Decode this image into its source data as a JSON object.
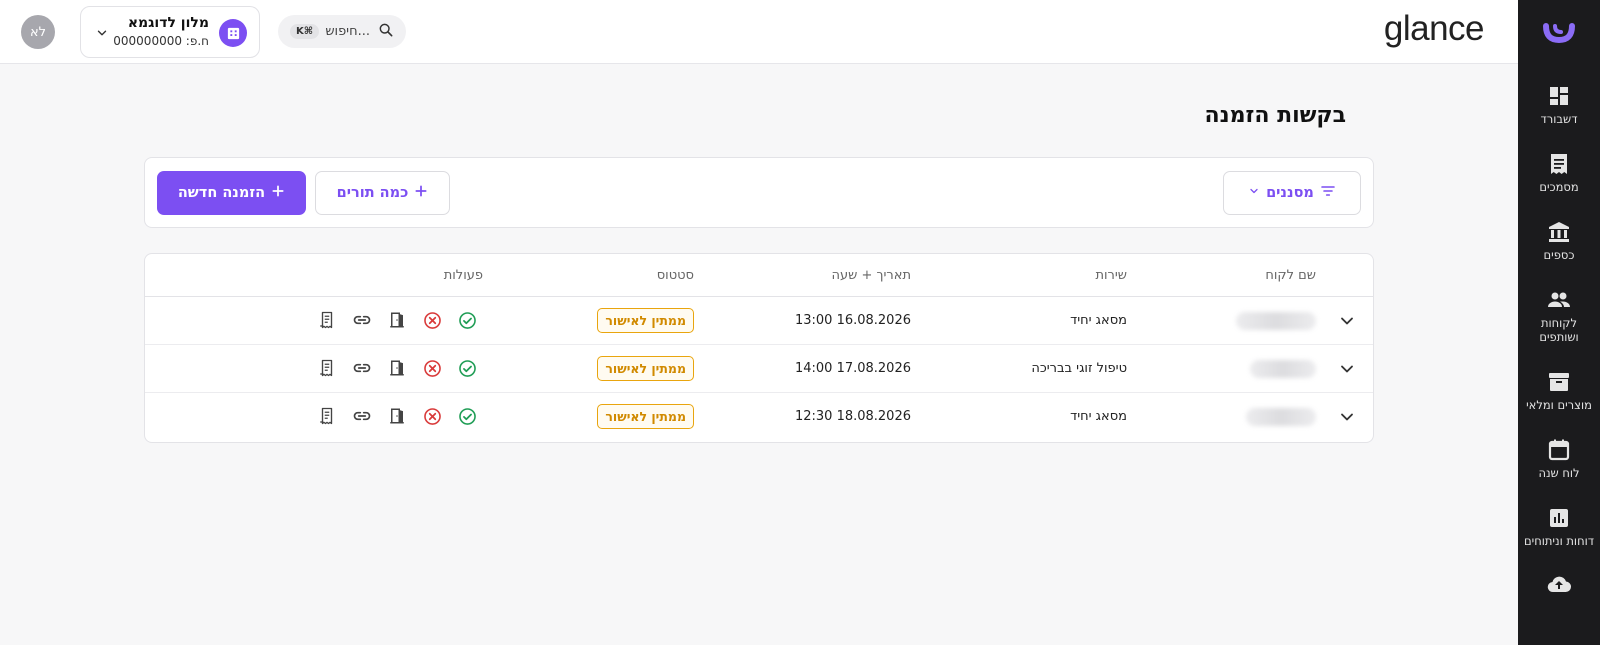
{
  "header": {
    "brand": "glance",
    "search": {
      "placeholder": "חיפוש...",
      "shortcut": "K⌘"
    },
    "business": {
      "name": "מלון לדוגמא",
      "phone": "ח.פ: 000000000"
    },
    "avatar_initials": "לא"
  },
  "sidebar": {
    "items": [
      {
        "label": "דשבורד",
        "icon": "dashboard-icon"
      },
      {
        "label": "מסמכים",
        "icon": "receipt-icon"
      },
      {
        "label": "כספים",
        "icon": "bank-icon"
      },
      {
        "label": "לקוחות ושותפים",
        "icon": "people-icon"
      },
      {
        "label": "מוצרים ומלאי",
        "icon": "archive-icon"
      },
      {
        "label": "לוח שנה",
        "icon": "calendar-icon"
      },
      {
        "label": "דוחות וניתוחים",
        "icon": "chart-icon"
      }
    ]
  },
  "main": {
    "title": "בקשות הזמנה",
    "toolbar": {
      "filters_label": "מסננים",
      "multi_label": "כמה תורים",
      "new_label": "הזמנה חדשה"
    },
    "table": {
      "columns": {
        "customer": "שם לקוח",
        "service": "שירות",
        "datetime": "תאריך + שעה",
        "status": "סטטוס",
        "actions": "פעולות"
      },
      "rows": [
        {
          "service": "מסאג יחיד",
          "datetime": "13:00 16.08.2026",
          "status": "ממתין לאישור"
        },
        {
          "service": "טיפול זוגי בבריכה",
          "datetime": "14:00 17.08.2026",
          "status": "ממתין לאישור"
        },
        {
          "service": "מסאג יחיד",
          "datetime": "12:30 18.08.2026",
          "status": "ממתין לאישור"
        }
      ]
    }
  },
  "colors": {
    "accent": "#7c4ff2",
    "sidebar_bg": "#1b1b1d",
    "approve": "#1f9d55",
    "reject": "#d93a3a",
    "pending": "#e9a50e"
  }
}
